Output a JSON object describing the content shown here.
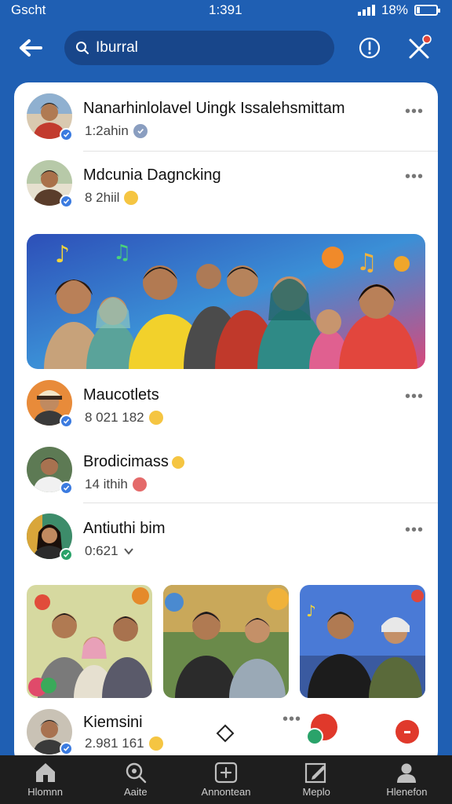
{
  "status": {
    "carrier": "Gscht",
    "time": "1:391",
    "battery": "18%",
    "battery_level": 0.18
  },
  "header": {
    "back_icon": "arrow-left-icon",
    "search_value": "Iburral",
    "info_icon": "exclamation-circle-icon",
    "close_icon": "close-x-icon"
  },
  "feed": [
    {
      "name": "Nanarhinlolavel Uingk Issalehsmittam",
      "meta": "1:2ahin",
      "meta_icon": "verified-check-icon",
      "menu": "•••"
    },
    {
      "name": "Mdcunia Dagncking",
      "meta": "8 2hiil",
      "meta_icon": "smile-emoji-icon",
      "menu": "•••"
    },
    {
      "name": "Maucotlets",
      "meta": "8 021 182",
      "meta_icon": "smile-emoji-icon",
      "menu": "•••"
    },
    {
      "name": "Brodicimass",
      "meta": "14 ithih",
      "meta_icon": "heart-emoji-icon"
    },
    {
      "name": "Antiuthi bim",
      "meta": "0:621",
      "meta_icon": "down-chevron-icon",
      "menu": "•••"
    },
    {
      "name": "Kiemsini",
      "meta": "2.981 161",
      "meta_icon": "smile-emoji-icon",
      "menu": "•••"
    }
  ],
  "nav": [
    {
      "label": "Hlomnn",
      "icon": "home-icon"
    },
    {
      "label": "Aaite",
      "icon": "search-icon"
    },
    {
      "label": "Annontean",
      "icon": "add-post-icon"
    },
    {
      "label": "Meplo",
      "icon": "edit-icon"
    },
    {
      "label": "Hlenefon",
      "icon": "profile-icon"
    }
  ],
  "colors": {
    "brand": "#1f5fb3",
    "card": "#ffffff",
    "nav_bg": "#1e1e1e",
    "badge": "#3b7be0"
  }
}
